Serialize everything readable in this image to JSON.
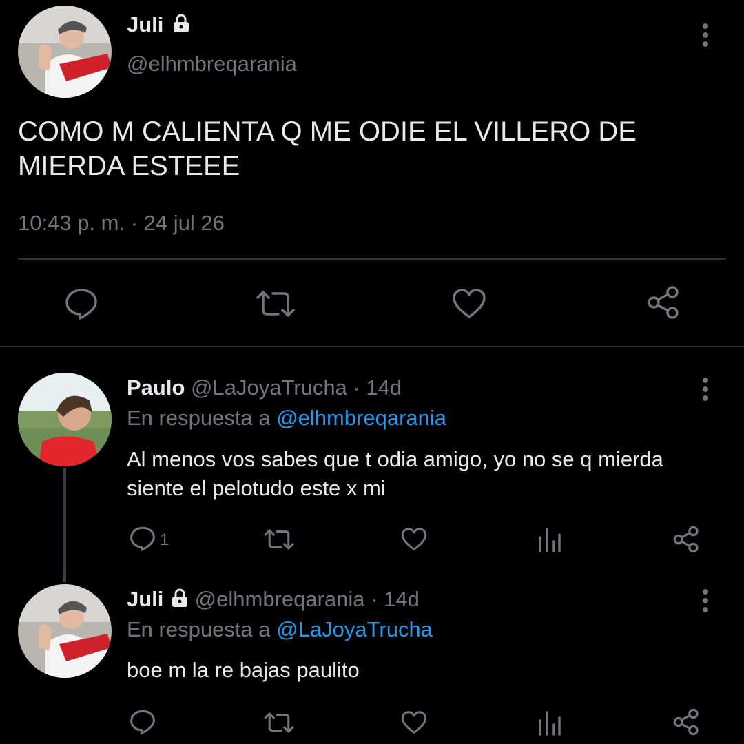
{
  "main_tweet": {
    "display_name": "Juli",
    "handle": "@elhmbreqarania",
    "text": "COMO M CALIENTA Q ME ODIE EL VILLERO DE MIERDA ESTEEE",
    "timestamp": "10:43 p. m. · 24 jul 26",
    "icons": [
      "reply-icon",
      "retweet-icon",
      "like-icon",
      "share-icon"
    ]
  },
  "replies": [
    {
      "display_name": "Paulo",
      "handle": "@LaJoyaTrucha",
      "age": "· 14d",
      "reply_prefix": "En respuesta a",
      "reply_to": "@elhmbreqarania",
      "text": "Al menos vos sabes que t odia amigo, yo no se q mierda siente el pelotudo este x mi",
      "reply_count": "1"
    },
    {
      "display_name": "Juli",
      "handle": "@elhmbreqarania",
      "age": "· 14d",
      "reply_prefix": "En respuesta a",
      "reply_to": "@LaJoyaTrucha",
      "text": "boe m la re bajas paulito",
      "reply_count": ""
    }
  ],
  "colors": {
    "background": "#000000",
    "text": "#e7e9ea",
    "secondary": "#71767b",
    "link": "#1d9bf0",
    "divider": "#2f3336"
  }
}
